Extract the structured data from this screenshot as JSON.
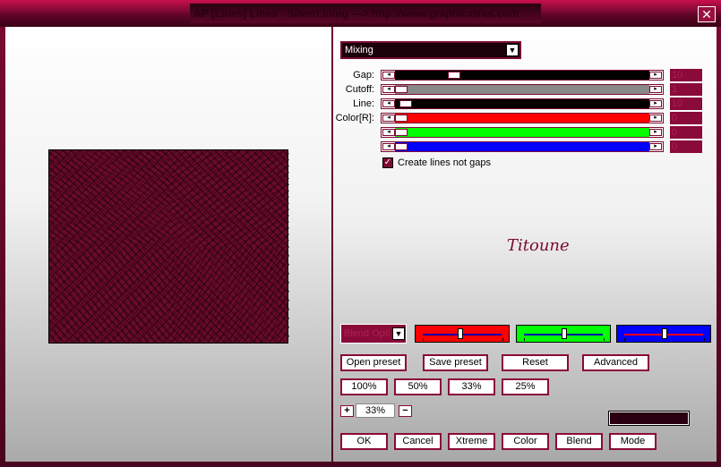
{
  "window": {
    "title": "AP [Lines]  Lines - SilverLining   ---> http://www.graphicxtras.com",
    "close_glyph": "✕"
  },
  "mode_select": {
    "value": "Mixing",
    "arrow": "▼"
  },
  "sliders": [
    {
      "label": "Gap:",
      "value": "10",
      "fill_color": "#000000",
      "thumb_pos": 0.22
    },
    {
      "label": "Cutoff:",
      "value": "1",
      "fill_color": "#888888",
      "thumb_pos": 0.0
    },
    {
      "label": "Line:",
      "value": "10",
      "fill_color": "#000000",
      "thumb_pos": 0.02
    },
    {
      "label": "Color[R]:",
      "value": "0",
      "fill_color": "#ff0000",
      "thumb_pos": 0.0
    },
    {
      "label": "",
      "value": "0",
      "fill_color": "#00ff00",
      "thumb_pos": 0.0
    },
    {
      "label": "",
      "value": "0",
      "fill_color": "#0000ff",
      "thumb_pos": 0.0
    }
  ],
  "slider_arrows": {
    "left": "◂",
    "right": "▸"
  },
  "checkbox": {
    "label": "Create lines not gaps",
    "checked": true,
    "glyph": "✓"
  },
  "signature": "Titoune",
  "blend": {
    "label": "Blend Opti",
    "arrow": "▼",
    "sliders": [
      {
        "color": "#ff0000",
        "line": "#0000aa",
        "level": 0.47
      },
      {
        "color": "#00ff00",
        "line": "#0000aa",
        "level": 0.5
      },
      {
        "color": "#0000ff",
        "line": "#ff0000",
        "level": 0.5
      }
    ]
  },
  "preset_buttons": {
    "open": "Open preset",
    "save": "Save preset",
    "reset": "Reset",
    "advanced": "Advanced"
  },
  "zoom_buttons": {
    "z100": "100%",
    "z50": "50%",
    "z33": "33%",
    "z25": "25%"
  },
  "zoom": {
    "plus": "+",
    "value": "33%",
    "minus": "−"
  },
  "action_buttons": {
    "ok": "OK",
    "cancel": "Cancel",
    "xtreme": "Xtreme",
    "color": "Color",
    "blend": "Blend",
    "mode": "Mode"
  },
  "colors": {
    "accent": "#8a0a3a",
    "title_gradient_top": "#c8104e",
    "swatch": "#2a0010",
    "preview": "#6a0a2c"
  }
}
